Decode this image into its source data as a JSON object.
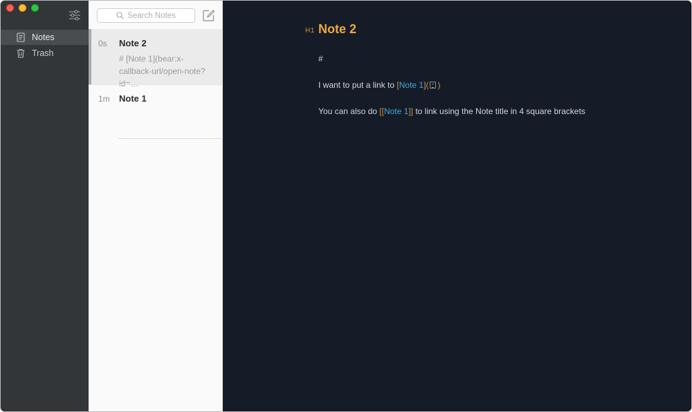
{
  "sidebar": {
    "items": [
      {
        "label": "Notes",
        "icon": "note-icon",
        "active": true
      },
      {
        "label": "Trash",
        "icon": "trash-icon",
        "active": false
      }
    ]
  },
  "list": {
    "search_placeholder": "Search Notes",
    "notes": [
      {
        "time": "0s",
        "title": "Note 2",
        "preview": "# [Note 1](bear:x-callback-url/open-note?id=…"
      },
      {
        "time": "1m",
        "title": "Note 1",
        "preview": ""
      }
    ]
  },
  "editor": {
    "h1_marker": "H1",
    "title": "Note 2",
    "hash_line": "#",
    "line2_prefix": "I want to put a link to ",
    "line2_open": "[",
    "line2_link": "Note 1",
    "line2_mid": "](",
    "line2_close": ")",
    "line3_prefix": "You can also do ",
    "line3_open": "[[",
    "line3_link": "Note 1",
    "line3_close": "]]",
    "line3_suffix": " to link using the Note title in 4 square brackets"
  },
  "colors": {
    "editor_bg": "#151c28",
    "title": "#f0a93d",
    "link": "#46a5d5",
    "bracket": "#c8963e"
  }
}
